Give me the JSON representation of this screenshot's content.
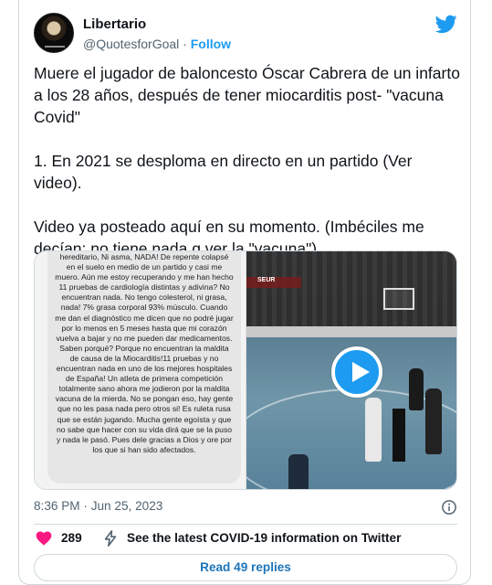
{
  "author": {
    "name": "Libertario",
    "handle": "@QuotesforGoal",
    "separator": " · ",
    "follow_label": "Follow"
  },
  "tweet": {
    "text": "Muere el jugador de baloncesto Óscar Cabrera de un infarto a los 28 años, después de tener miocarditis post- \"vacuna Covid\"\n\n1. En 2021 se desploma en directo en un partido (Ver video).\n\nVideo ya posteado aquí en su momento. (Imbéciles me decían: no tiene nada q ver la \"vacuna\")",
    "screenshot_text": "hereditario, Ni asma, NADA! De repente colapsé en el suelo en medio de un partido y casi me muero. Aún me estoy recuperando y me han hecho 11 pruebas de cardiología distintas y adivina? No encuentran nada. No tengo colesterol, ni grasa, nada! 7% grasa corporal 93% músculo. Cuando me dan el diagnóstico me dicen que no podré jugar por lo menos en 5 meses hasta que mi corazón vuelva a bajar y no me pueden dar medicamentos. Saben porqué? Porque no encuentran la maldita de causa de la Miocarditis!11 pruebas y no encuentran nada en uno de los mejores hospitales de España! Un atleta de primera competición totalmente sano ahora me jodieron por la maldita vacuna de la mierda. No se pongan eso, hay gente que no les pasa nada pero otros si! Es ruleta rusa que se están jugando. Mucha gente egoísta y que no sabe que hacer con su vida dirá que se la puso y nada le pasó. Pues dele gracias a Dios y ore por los que si han sido afectados.",
    "video_banner": "SEUR",
    "timestamp": "8:36 PM · Jun 25, 2023"
  },
  "actions": {
    "likes": "289",
    "covid_link": "See the latest COVID-19 information on Twitter",
    "replies_button": "Read 49 replies"
  },
  "colors": {
    "accent": "#1d9bf0",
    "heart": "#f91880",
    "text_secondary": "#536471",
    "border": "#cfd9de"
  },
  "icons": [
    "twitter-bird-icon",
    "play-icon",
    "info-icon",
    "heart-icon",
    "lightning-icon"
  ]
}
